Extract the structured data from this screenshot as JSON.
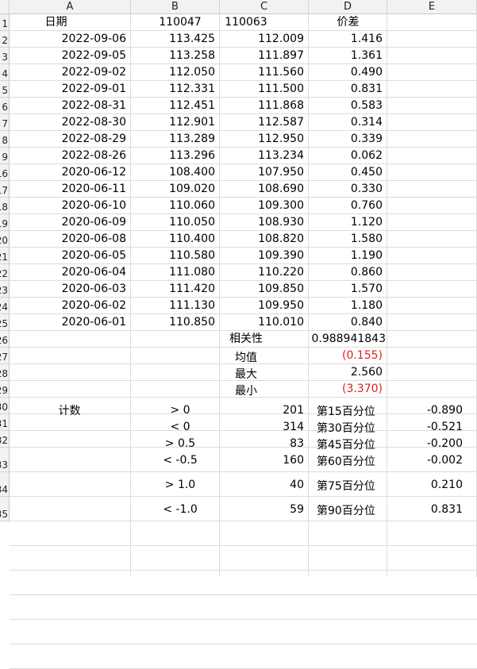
{
  "columns": [
    "A",
    "B",
    "C",
    "D",
    "E"
  ],
  "header_row": {
    "row_num": "1",
    "a": "日期",
    "b": "110047",
    "c": "110063",
    "d": "价差"
  },
  "rows": [
    {
      "num": "2",
      "date": "2022-09-06",
      "b": "113.425",
      "c": "112.009",
      "d": "1.416"
    },
    {
      "num": "3",
      "date": "2022-09-05",
      "b": "113.258",
      "c": "111.897",
      "d": "1.361"
    },
    {
      "num": "4",
      "date": "2022-09-02",
      "b": "112.050",
      "c": "111.560",
      "d": "0.490"
    },
    {
      "num": "5",
      "date": "2022-09-01",
      "b": "112.331",
      "c": "111.500",
      "d": "0.831"
    },
    {
      "num": "6",
      "date": "2022-08-31",
      "b": "112.451",
      "c": "111.868",
      "d": "0.583"
    },
    {
      "num": "7",
      "date": "2022-08-30",
      "b": "112.901",
      "c": "112.587",
      "d": "0.314"
    },
    {
      "num": "8",
      "date": "2022-08-29",
      "b": "113.289",
      "c": "112.950",
      "d": "0.339"
    },
    {
      "num": "9",
      "date": "2022-08-26",
      "b": "113.296",
      "c": "113.234",
      "d": "0.062"
    },
    {
      "num": "16",
      "date": "2020-06-12",
      "b": "108.400",
      "c": "107.950",
      "d": "0.450"
    },
    {
      "num": "17",
      "date": "2020-06-11",
      "b": "109.020",
      "c": "108.690",
      "d": "0.330"
    },
    {
      "num": "18",
      "date": "2020-06-10",
      "b": "110.060",
      "c": "109.300",
      "d": "0.760"
    },
    {
      "num": "19",
      "date": "2020-06-09",
      "b": "110.050",
      "c": "108.930",
      "d": "1.120"
    },
    {
      "num": "20",
      "date": "2020-06-08",
      "b": "110.400",
      "c": "108.820",
      "d": "1.580"
    },
    {
      "num": "21",
      "date": "2020-06-05",
      "b": "110.580",
      "c": "109.390",
      "d": "1.190"
    },
    {
      "num": "22",
      "date": "2020-06-04",
      "b": "111.080",
      "c": "110.220",
      "d": "0.860"
    },
    {
      "num": "23",
      "date": "2020-06-03",
      "b": "111.420",
      "c": "109.850",
      "d": "1.570"
    },
    {
      "num": "24",
      "date": "2020-06-02",
      "b": "111.130",
      "c": "109.950",
      "d": "1.180"
    },
    {
      "num": "25",
      "date": "2020-06-01",
      "b": "110.850",
      "c": "110.010",
      "d": "0.840"
    }
  ],
  "stats": [
    {
      "num": "26",
      "label": "相关性",
      "value": "0.988941843",
      "negative": false
    },
    {
      "num": "27",
      "label": "均值",
      "value": "(0.155)",
      "negative": true
    },
    {
      "num": "28",
      "label": "最大",
      "value": "2.560",
      "negative": false
    },
    {
      "num": "29",
      "label": "最小",
      "value": "(3.370)",
      "negative": true
    }
  ],
  "count_label": "计数",
  "count_rows": [
    {
      "num": "30",
      "cond": "> 0",
      "count": "201",
      "pct_label": "第15百分位",
      "pct_value": "-0.890"
    },
    {
      "num": "31",
      "cond": "< 0",
      "count": "314",
      "pct_label": "第30百分位",
      "pct_value": "-0.521"
    },
    {
      "num": "32",
      "cond": "> 0.5",
      "count": "83",
      "pct_label": "第45百分位",
      "pct_value": "-0.200"
    },
    {
      "num": "33",
      "cond": "< -0.5",
      "count": "160",
      "pct_label": "第60百分位",
      "pct_value": "-0.002"
    },
    {
      "num": "34",
      "cond": "> 1.0",
      "count": "40",
      "pct_label": "第75百分位",
      "pct_value": "0.210"
    },
    {
      "num": "35",
      "cond": "< -1.0",
      "count": "59",
      "pct_label": "第90百分位",
      "pct_value": "0.831"
    }
  ],
  "colors": {
    "negative": "#e0201b",
    "header_bg": "#f2f2f2",
    "gridline": "#dcdcdc"
  }
}
